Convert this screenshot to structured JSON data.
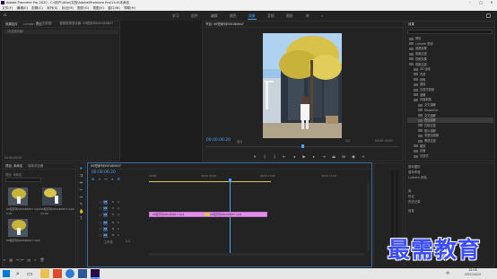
{
  "window": {
    "title": "Adobe Premiere Pro 2020 - C:\\用户\\Ufoo\\文档\\Adobe\\Premiere Pro\\14.0\\未命名",
    "min": "–",
    "max": "□",
    "close": "✕"
  },
  "menu": [
    "文件(F)",
    "编辑(E)",
    "剪辑(C)",
    "序列(S)",
    "标记(M)",
    "图形(G)",
    "视图(V)",
    "窗口(W)",
    "帮助(H)"
  ],
  "workspaces": {
    "items": [
      "学习",
      "组件",
      "编辑",
      "颜色",
      "效果",
      "音频",
      "图形",
      "库"
    ],
    "active_index": 4,
    "more": "»"
  },
  "source_panel": {
    "tabs": [
      "效果控件",
      "Lumetri 范围",
      "源（无剪辑）",
      "音频剪辑混合器: 00短序列000180607"
    ],
    "active_index": 0,
    "no_clip": "（未选择剪辑）",
    "timecode": "00:00:00:00"
  },
  "program_panel": {
    "title": "节目: 00短序列000180607",
    "timecode_current": "00:00:06:20",
    "fit": "适合",
    "scale": "1/2",
    "timecode_total": "00:00:13:00"
  },
  "effects_panel": {
    "title": "效果",
    "tree": [
      {
        "label": "预设",
        "level": 0
      },
      {
        "label": "Lumetri 预设",
        "level": 0
      },
      {
        "label": "音频效果",
        "level": 0
      },
      {
        "label": "音频过渡",
        "level": 0
      },
      {
        "label": "视频效果",
        "level": 0
      },
      {
        "label": "视频过渡",
        "level": 0
      },
      {
        "label": "3D 运动",
        "level": 1
      },
      {
        "label": "内滑",
        "level": 1
      },
      {
        "label": "划像",
        "level": 1
      },
      {
        "label": "擦除",
        "level": 1
      },
      {
        "label": "沉浸式视频",
        "level": 1
      },
      {
        "label": "溶解",
        "level": 1
      },
      {
        "label": "页面剥落",
        "level": 1
      },
      {
        "label": "交叉溶解",
        "level": 2
      },
      {
        "label": "MorphCut",
        "level": 2
      },
      {
        "label": "交叉溶解",
        "level": 2
      },
      {
        "label": "叠加溶解",
        "level": 2
      },
      {
        "label": "白场过渡",
        "level": 2
      },
      {
        "label": "胶片溶解",
        "level": 2
      },
      {
        "label": "非叠加溶解",
        "level": 2
      },
      {
        "label": "黑场过渡",
        "level": 2
      },
      {
        "label": "缩放",
        "level": 1
      },
      {
        "label": "页面",
        "level": 1
      },
      {
        "label": "沉浸式",
        "level": 1
      }
    ],
    "selected_index": 16
  },
  "right_panels": [
    "基本图形",
    "基本声音",
    "Lumetri 颜色",
    "库",
    "标记",
    "历史记录",
    "信息"
  ],
  "project_panel": {
    "tabs": [
      "项目: 未命名",
      "媒体浏览器"
    ],
    "active_index": 0,
    "search_placeholder": "",
    "items": [
      {
        "name": "00短序列000180607.mp4",
        "duration": "5:01"
      },
      {
        "name": "00短序列000180607.mp4",
        "duration": "13:00"
      },
      {
        "name": "00短序列000180607.mp4",
        "duration": ""
      }
    ]
  },
  "timeline": {
    "title": "00短序列000180607",
    "timecode": "00:00:06:20",
    "ruler": [
      "00:00",
      "00:00:05:00",
      "00:00:10:00",
      "00:00:15:00"
    ],
    "video_tracks": [
      "V3",
      "V2",
      "V1"
    ],
    "audio_tracks": [
      "A1",
      "A2",
      "A3"
    ],
    "master": "主声道",
    "master_value": "0.0",
    "clips": [
      {
        "label": "00短序列000180607.mp4",
        "track": "V1"
      },
      {
        "label": "00短序列000180607.mp4",
        "track": "V1"
      }
    ]
  },
  "taskbar": {
    "time": "16:08",
    "date": "2021/10/22",
    "lang": "中"
  },
  "watermark": "最需教育",
  "colors": {
    "accent": "#4aa3ff",
    "clip": "#e090e8",
    "panel": "#232323",
    "watermark": "#3a4cff"
  }
}
